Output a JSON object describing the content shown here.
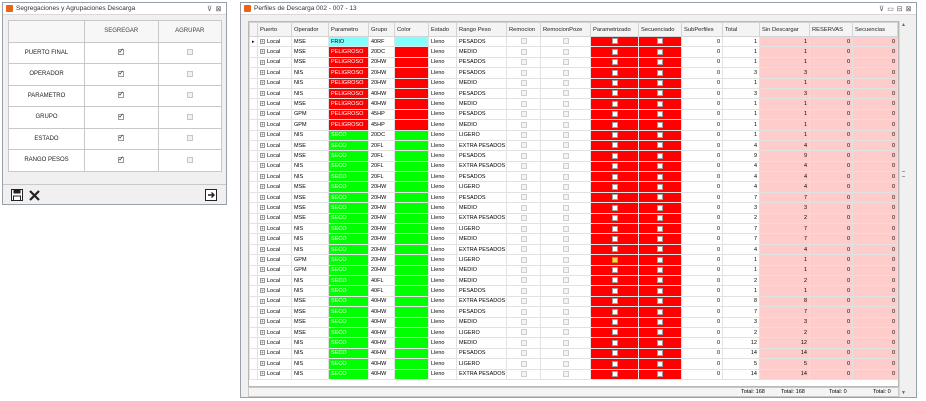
{
  "window_left": {
    "title": "Segregaciones y Agrupaciones Descarga",
    "col_segregar": "SEGREGAR",
    "col_agrupar": "AGRUPAR",
    "rows": [
      {
        "label": "PUERTO FINAL",
        "segregar": true
      },
      {
        "label": "OPERADOR",
        "segregar": true
      },
      {
        "label": "PARAMETRO",
        "segregar": true
      },
      {
        "label": "GRUPO",
        "segregar": true
      },
      {
        "label": "ESTADO",
        "segregar": true
      },
      {
        "label": "RANGO PESOS",
        "segregar": true
      }
    ],
    "icons": [
      "save-icon",
      "close-icon",
      "exit-icon"
    ]
  },
  "window_right": {
    "title": "Perfiles de Descarga 002 - 007 - 13",
    "columns": [
      "Puerto",
      "Operador",
      "Parametro",
      "Grupo",
      "Color",
      "Estado",
      "Rango Peso",
      "Remocion",
      "RemocionPoze",
      "Parametrizado",
      "Secuenciado",
      "SubPerfiles",
      "Total",
      "Sin Descargar",
      "RESERVAS",
      "Secuencias"
    ],
    "colors": {
      "peligroso": "#ff0000",
      "seco": "#00ff00",
      "frio": "#80ffff",
      "pink": "#ffcccc"
    },
    "rows": [
      [
        "Local",
        "MSE",
        "FRIO",
        "40RF",
        "frio",
        "Lleno",
        "PESADOS",
        "0",
        "1",
        "1",
        "0",
        "0"
      ],
      [
        "Local",
        "MSE",
        "PELIGROSO",
        "20DC",
        "pel",
        "Lleno",
        "MEDIO",
        "0",
        "1",
        "1",
        "0",
        "0"
      ],
      [
        "Local",
        "MSE",
        "PELIGROSO",
        "20HW",
        "pel",
        "Lleno",
        "PESADOS",
        "0",
        "1",
        "1",
        "0",
        "0"
      ],
      [
        "Local",
        "NIS",
        "PELIGROSO",
        "20HW",
        "pel",
        "Lleno",
        "PESADOS",
        "0",
        "3",
        "3",
        "0",
        "0"
      ],
      [
        "Local",
        "NIS",
        "PELIGROSO",
        "20HW",
        "pel",
        "Lleno",
        "MEDIO",
        "0",
        "1",
        "1",
        "0",
        "0"
      ],
      [
        "Local",
        "NIS",
        "PELIGROSO",
        "40HW",
        "pel",
        "Lleno",
        "PESADOS",
        "0",
        "3",
        "3",
        "0",
        "0"
      ],
      [
        "Local",
        "MSE",
        "PELIGROSO",
        "40HW",
        "pel",
        "Lleno",
        "MEDIO",
        "0",
        "1",
        "1",
        "0",
        "0"
      ],
      [
        "Local",
        "GPM",
        "PELIGROSO",
        "45HP",
        "pel",
        "Lleno",
        "PESADOS",
        "0",
        "1",
        "1",
        "0",
        "0"
      ],
      [
        "Local",
        "GPM",
        "PELIGROSO",
        "45HP",
        "pel",
        "Lleno",
        "MEDIO",
        "0",
        "1",
        "1",
        "0",
        "0"
      ],
      [
        "Local",
        "NIS",
        "SECO",
        "20DC",
        "seco",
        "Lleno",
        "LIGERO",
        "0",
        "1",
        "1",
        "0",
        "0"
      ],
      [
        "Local",
        "MSE",
        "SECO",
        "20FL",
        "seco",
        "Lleno",
        "EXTRA PESADOS",
        "0",
        "4",
        "4",
        "0",
        "0"
      ],
      [
        "Local",
        "MSE",
        "SECO",
        "20FL",
        "seco",
        "Lleno",
        "PESADOS",
        "0",
        "9",
        "9",
        "0",
        "0"
      ],
      [
        "Local",
        "NIS",
        "SECO",
        "20FL",
        "seco",
        "Lleno",
        "EXTRA PESADOS",
        "0",
        "4",
        "4",
        "0",
        "0"
      ],
      [
        "Local",
        "NIS",
        "SECO",
        "20FL",
        "seco",
        "Lleno",
        "PESADOS",
        "0",
        "4",
        "4",
        "0",
        "0"
      ],
      [
        "Local",
        "MSE",
        "SECO",
        "20HW",
        "seco",
        "Lleno",
        "LIGERO",
        "0",
        "4",
        "4",
        "0",
        "0"
      ],
      [
        "Local",
        "MSE",
        "SECO",
        "20HW",
        "seco",
        "Lleno",
        "PESADOS",
        "0",
        "7",
        "7",
        "0",
        "0"
      ],
      [
        "Local",
        "MSE",
        "SECO",
        "20HW",
        "seco",
        "Lleno",
        "MEDIO",
        "0",
        "3",
        "3",
        "0",
        "0"
      ],
      [
        "Local",
        "MSE",
        "SECO",
        "20HW",
        "seco",
        "Lleno",
        "EXTRA PESADOS",
        "0",
        "2",
        "2",
        "0",
        "0"
      ],
      [
        "Local",
        "NIS",
        "SECO",
        "20HW",
        "seco",
        "Lleno",
        "LIGERO",
        "0",
        "7",
        "7",
        "0",
        "0"
      ],
      [
        "Local",
        "NIS",
        "SECO",
        "20HW",
        "seco",
        "Lleno",
        "MEDIO",
        "0",
        "7",
        "7",
        "0",
        "0"
      ],
      [
        "Local",
        "NIS",
        "SECO",
        "20HW",
        "seco",
        "Lleno",
        "EXTRA PESADOS",
        "0",
        "4",
        "4",
        "0",
        "0"
      ],
      [
        "Local",
        "GPM",
        "SECO",
        "20HW",
        "seco",
        "Lleno",
        "LIGERO",
        "0",
        "1",
        "1",
        "0",
        "0"
      ],
      [
        "Local",
        "GPM",
        "SECO",
        "20HW",
        "seco",
        "Lleno",
        "MEDIO",
        "0",
        "1",
        "1",
        "0",
        "0"
      ],
      [
        "Local",
        "NIS",
        "SECO",
        "40FL",
        "seco",
        "Lleno",
        "MEDIO",
        "0",
        "2",
        "2",
        "0",
        "0"
      ],
      [
        "Local",
        "NIS",
        "SECO",
        "40FL",
        "seco",
        "Lleno",
        "PESADOS",
        "0",
        "1",
        "1",
        "0",
        "0"
      ],
      [
        "Local",
        "MSE",
        "SECO",
        "40HW",
        "seco",
        "Lleno",
        "EXTRA PESADOS",
        "0",
        "8",
        "8",
        "0",
        "0"
      ],
      [
        "Local",
        "MSE",
        "SECO",
        "40HW",
        "seco",
        "Lleno",
        "PESADOS",
        "0",
        "7",
        "7",
        "0",
        "0"
      ],
      [
        "Local",
        "MSE",
        "SECO",
        "40HW",
        "seco",
        "Lleno",
        "MEDIO",
        "0",
        "3",
        "3",
        "0",
        "0"
      ],
      [
        "Local",
        "MSE",
        "SECO",
        "40HW",
        "seco",
        "Lleno",
        "LIGERO",
        "0",
        "2",
        "2",
        "0",
        "0"
      ],
      [
        "Local",
        "NIS",
        "SECO",
        "40HW",
        "seco",
        "Lleno",
        "MEDIO",
        "0",
        "12",
        "12",
        "0",
        "0"
      ],
      [
        "Local",
        "NIS",
        "SECO",
        "40HW",
        "seco",
        "Lleno",
        "PESADOS",
        "0",
        "14",
        "14",
        "0",
        "0"
      ],
      [
        "Local",
        "NIS",
        "SECO",
        "40HW",
        "seco",
        "Lleno",
        "LIGERO",
        "0",
        "5",
        "5",
        "0",
        "0"
      ],
      [
        "Local",
        "NIS",
        "SECO",
        "40HW",
        "seco",
        "Lleno",
        "EXTRA PESADOS",
        "0",
        "14",
        "14",
        "0",
        "0"
      ]
    ],
    "footer": {
      "total": "Total: 168",
      "sin_descargar": "Total: 168",
      "reservas": "Total: 0",
      "secuencias": "Total: 0"
    }
  }
}
